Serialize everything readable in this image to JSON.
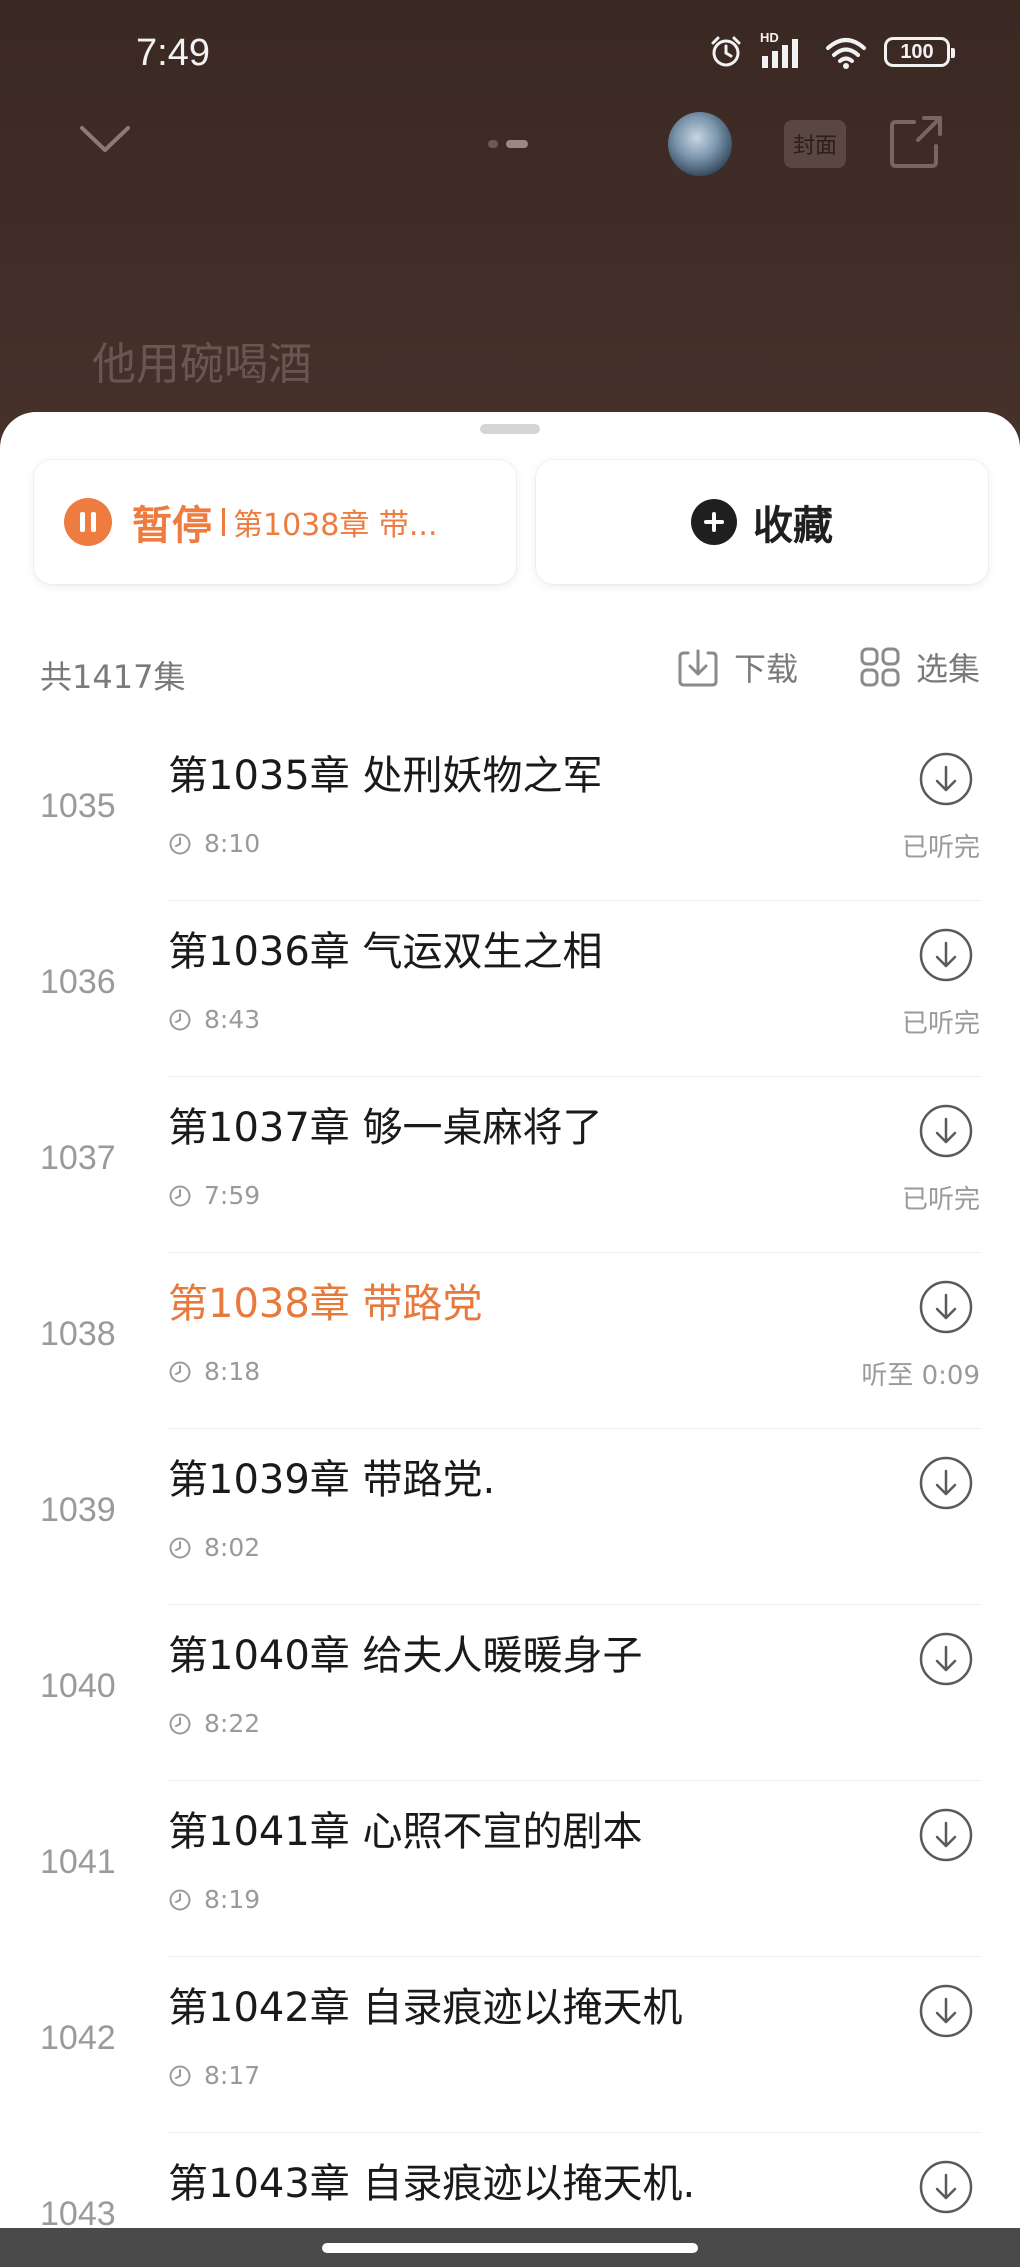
{
  "status_bar": {
    "time": "7:49",
    "network": "HD",
    "battery": "100"
  },
  "player": {
    "cover_label": "封面",
    "lyric_line": "他用碗喝酒"
  },
  "actions": {
    "pause_label": "暂停",
    "now_playing": "第1038章 带...",
    "favorite_label": "收藏"
  },
  "list_header": {
    "total": "共1417集",
    "download_label": "下载",
    "select_label": "选集"
  },
  "colors": {
    "accent": "#ee7b3f",
    "current_title": "#e8793c",
    "muted": "#9a9a9a"
  },
  "chapters": [
    {
      "num": "1035",
      "title": "第1035章 处刑妖物之军",
      "duration": "8:10",
      "status": "已听完"
    },
    {
      "num": "1036",
      "title": "第1036章 气运双生之相",
      "duration": "8:43",
      "status": "已听完"
    },
    {
      "num": "1037",
      "title": "第1037章 够一桌麻将了",
      "duration": "7:59",
      "status": "已听完"
    },
    {
      "num": "1038",
      "title": "第1038章 带路党",
      "duration": "8:18",
      "status": "听至 0:09",
      "current": true
    },
    {
      "num": "1039",
      "title": "第1039章 带路党.",
      "duration": "8:02",
      "status": ""
    },
    {
      "num": "1040",
      "title": "第1040章 给夫人暖暖身子",
      "duration": "8:22",
      "status": ""
    },
    {
      "num": "1041",
      "title": "第1041章 心照不宣的剧本",
      "duration": "8:19",
      "status": ""
    },
    {
      "num": "1042",
      "title": "第1042章 自录痕迹以掩天机",
      "duration": "8:17",
      "status": ""
    },
    {
      "num": "1043",
      "title": "第1043章 自录痕迹以掩天机.",
      "duration": "",
      "status": ""
    }
  ]
}
